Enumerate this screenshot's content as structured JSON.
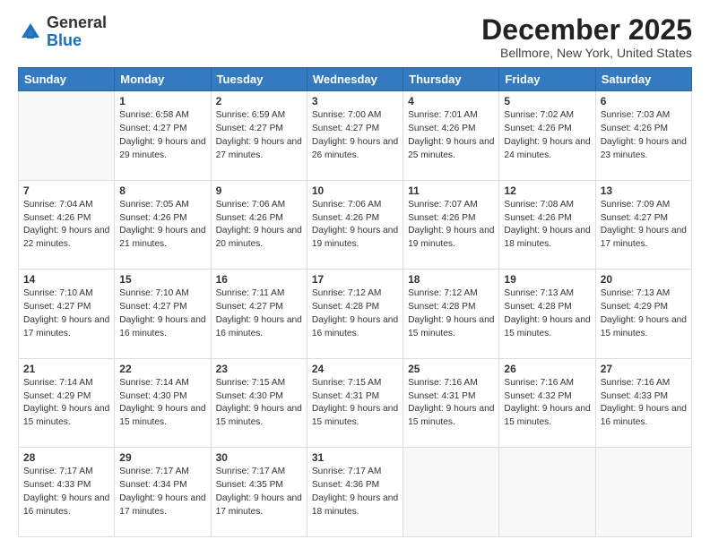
{
  "logo": {
    "general": "General",
    "blue": "Blue"
  },
  "title": "December 2025",
  "subtitle": "Bellmore, New York, United States",
  "days_of_week": [
    "Sunday",
    "Monday",
    "Tuesday",
    "Wednesday",
    "Thursday",
    "Friday",
    "Saturday"
  ],
  "weeks": [
    [
      {
        "day": "",
        "empty": true
      },
      {
        "day": "1",
        "sunrise": "6:58 AM",
        "sunset": "4:27 PM",
        "daylight": "9 hours and 29 minutes."
      },
      {
        "day": "2",
        "sunrise": "6:59 AM",
        "sunset": "4:27 PM",
        "daylight": "9 hours and 27 minutes."
      },
      {
        "day": "3",
        "sunrise": "7:00 AM",
        "sunset": "4:27 PM",
        "daylight": "9 hours and 26 minutes."
      },
      {
        "day": "4",
        "sunrise": "7:01 AM",
        "sunset": "4:26 PM",
        "daylight": "9 hours and 25 minutes."
      },
      {
        "day": "5",
        "sunrise": "7:02 AM",
        "sunset": "4:26 PM",
        "daylight": "9 hours and 24 minutes."
      },
      {
        "day": "6",
        "sunrise": "7:03 AM",
        "sunset": "4:26 PM",
        "daylight": "9 hours and 23 minutes."
      }
    ],
    [
      {
        "day": "7",
        "sunrise": "7:04 AM",
        "sunset": "4:26 PM",
        "daylight": "9 hours and 22 minutes."
      },
      {
        "day": "8",
        "sunrise": "7:05 AM",
        "sunset": "4:26 PM",
        "daylight": "9 hours and 21 minutes."
      },
      {
        "day": "9",
        "sunrise": "7:06 AM",
        "sunset": "4:26 PM",
        "daylight": "9 hours and 20 minutes."
      },
      {
        "day": "10",
        "sunrise": "7:06 AM",
        "sunset": "4:26 PM",
        "daylight": "9 hours and 19 minutes."
      },
      {
        "day": "11",
        "sunrise": "7:07 AM",
        "sunset": "4:26 PM",
        "daylight": "9 hours and 19 minutes."
      },
      {
        "day": "12",
        "sunrise": "7:08 AM",
        "sunset": "4:26 PM",
        "daylight": "9 hours and 18 minutes."
      },
      {
        "day": "13",
        "sunrise": "7:09 AM",
        "sunset": "4:27 PM",
        "daylight": "9 hours and 17 minutes."
      }
    ],
    [
      {
        "day": "14",
        "sunrise": "7:10 AM",
        "sunset": "4:27 PM",
        "daylight": "9 hours and 17 minutes."
      },
      {
        "day": "15",
        "sunrise": "7:10 AM",
        "sunset": "4:27 PM",
        "daylight": "9 hours and 16 minutes."
      },
      {
        "day": "16",
        "sunrise": "7:11 AM",
        "sunset": "4:27 PM",
        "daylight": "9 hours and 16 minutes."
      },
      {
        "day": "17",
        "sunrise": "7:12 AM",
        "sunset": "4:28 PM",
        "daylight": "9 hours and 16 minutes."
      },
      {
        "day": "18",
        "sunrise": "7:12 AM",
        "sunset": "4:28 PM",
        "daylight": "9 hours and 15 minutes."
      },
      {
        "day": "19",
        "sunrise": "7:13 AM",
        "sunset": "4:28 PM",
        "daylight": "9 hours and 15 minutes."
      },
      {
        "day": "20",
        "sunrise": "7:13 AM",
        "sunset": "4:29 PM",
        "daylight": "9 hours and 15 minutes."
      }
    ],
    [
      {
        "day": "21",
        "sunrise": "7:14 AM",
        "sunset": "4:29 PM",
        "daylight": "9 hours and 15 minutes."
      },
      {
        "day": "22",
        "sunrise": "7:14 AM",
        "sunset": "4:30 PM",
        "daylight": "9 hours and 15 minutes."
      },
      {
        "day": "23",
        "sunrise": "7:15 AM",
        "sunset": "4:30 PM",
        "daylight": "9 hours and 15 minutes."
      },
      {
        "day": "24",
        "sunrise": "7:15 AM",
        "sunset": "4:31 PM",
        "daylight": "9 hours and 15 minutes."
      },
      {
        "day": "25",
        "sunrise": "7:16 AM",
        "sunset": "4:31 PM",
        "daylight": "9 hours and 15 minutes."
      },
      {
        "day": "26",
        "sunrise": "7:16 AM",
        "sunset": "4:32 PM",
        "daylight": "9 hours and 15 minutes."
      },
      {
        "day": "27",
        "sunrise": "7:16 AM",
        "sunset": "4:33 PM",
        "daylight": "9 hours and 16 minutes."
      }
    ],
    [
      {
        "day": "28",
        "sunrise": "7:17 AM",
        "sunset": "4:33 PM",
        "daylight": "9 hours and 16 minutes."
      },
      {
        "day": "29",
        "sunrise": "7:17 AM",
        "sunset": "4:34 PM",
        "daylight": "9 hours and 17 minutes."
      },
      {
        "day": "30",
        "sunrise": "7:17 AM",
        "sunset": "4:35 PM",
        "daylight": "9 hours and 17 minutes."
      },
      {
        "day": "31",
        "sunrise": "7:17 AM",
        "sunset": "4:36 PM",
        "daylight": "9 hours and 18 minutes."
      },
      {
        "day": "",
        "empty": true
      },
      {
        "day": "",
        "empty": true
      },
      {
        "day": "",
        "empty": true
      }
    ]
  ],
  "labels": {
    "sunrise": "Sunrise:",
    "sunset": "Sunset:",
    "daylight": "Daylight:"
  }
}
